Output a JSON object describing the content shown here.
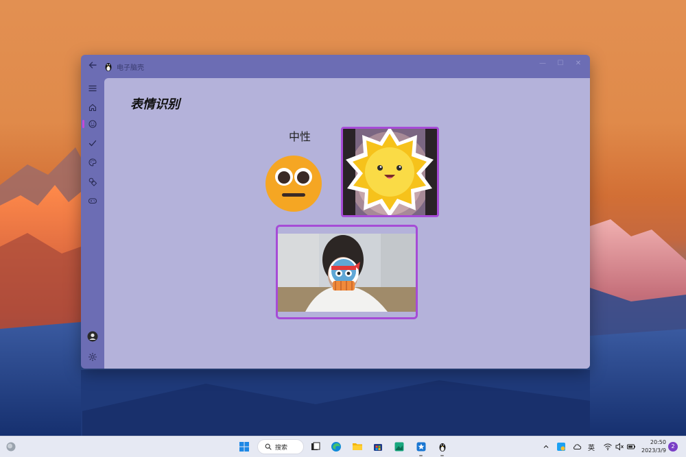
{
  "window": {
    "title": "电子脑壳",
    "controls": {
      "minimize": "—",
      "maximize": "☐",
      "close": "✕"
    }
  },
  "sidebar": {
    "items": [
      {
        "name": "menu",
        "icon": "hamburger-menu-icon"
      },
      {
        "name": "home",
        "icon": "home-icon"
      },
      {
        "name": "emotion",
        "icon": "smiley-icon",
        "selected": true
      },
      {
        "name": "tasks",
        "icon": "checkmark-icon"
      },
      {
        "name": "palette",
        "icon": "palette-icon"
      },
      {
        "name": "shapes",
        "icon": "shapes-icon"
      },
      {
        "name": "game",
        "icon": "gamepad-icon"
      }
    ],
    "bottom": [
      {
        "name": "account",
        "icon": "avatar-icon"
      },
      {
        "name": "settings",
        "icon": "gear-icon"
      }
    ]
  },
  "page": {
    "title": "表情识别",
    "emotion_label": "中性"
  },
  "taskbar": {
    "search_label": "搜索",
    "ime_label": "英",
    "time": "20:50",
    "date": "2023/3/9",
    "notification_count": "2"
  },
  "colors": {
    "window_bg": "#6c6db4",
    "content_bg": "#b4b2da",
    "accent": "#a64bd6"
  }
}
